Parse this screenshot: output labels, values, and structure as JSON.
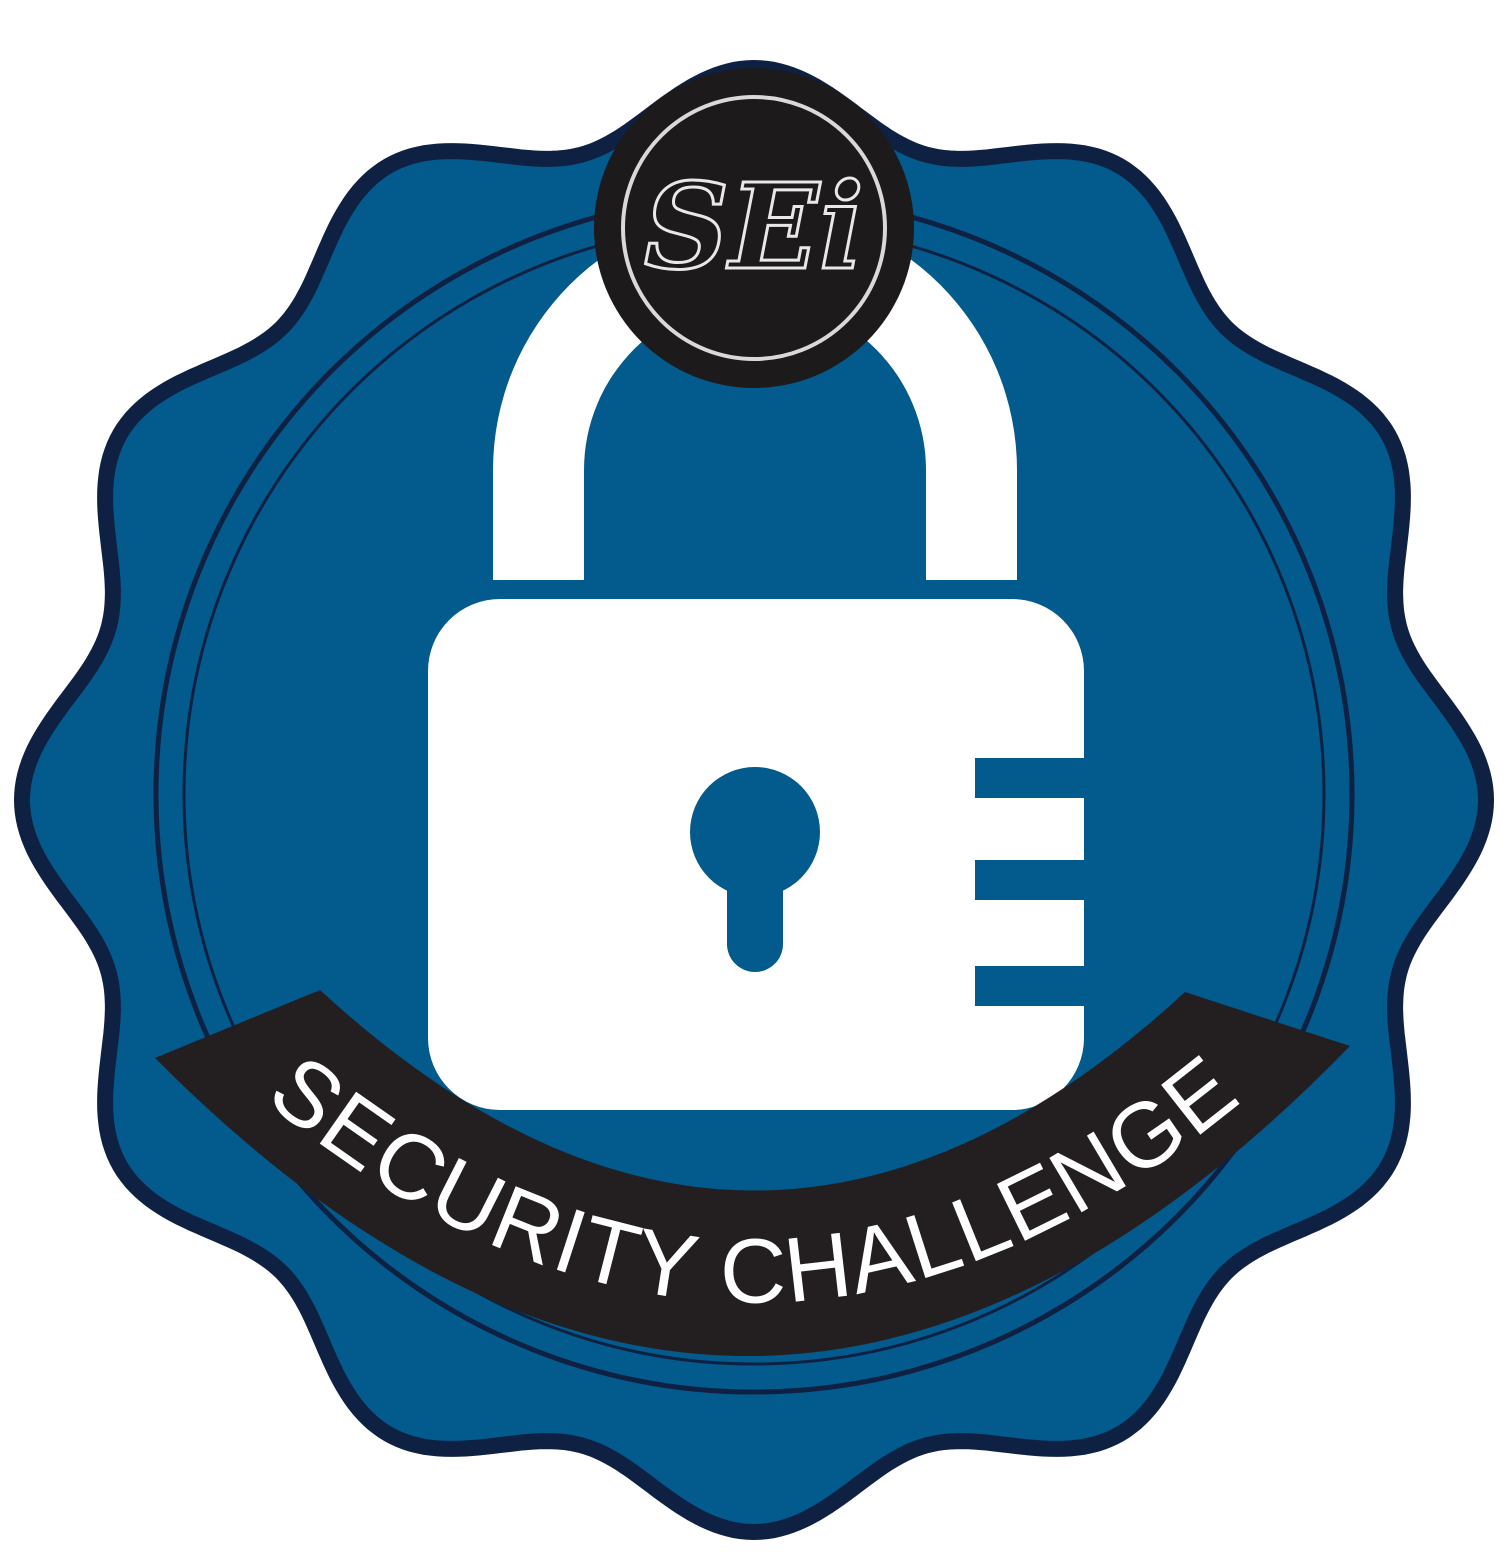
{
  "badge": {
    "banner_text": "SECURITY CHALLENGE",
    "logo_text": "SEi",
    "icon": "padlock-icon"
  },
  "colors": {
    "badge_blue": "#035A8C",
    "outline_navy": "#0F2143",
    "banner_black": "#231F20",
    "logo_black": "#1C1A1B",
    "white": "#FFFFFF"
  }
}
